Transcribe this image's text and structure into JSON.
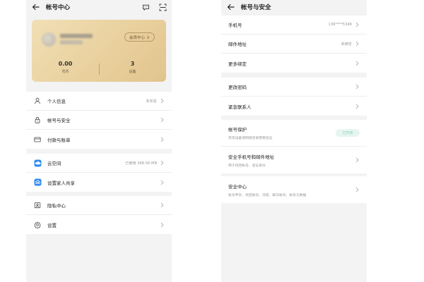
{
  "left": {
    "title": "帐号中心",
    "card": {
      "member_button": "会员中心",
      "stats": [
        {
          "value": "0.00",
          "label": "花币"
        },
        {
          "value": "3",
          "label": "设备"
        }
      ]
    },
    "items": [
      {
        "label": "个人信息",
        "value": "未实名",
        "icon": "person-icon"
      },
      {
        "label": "帐号与安全",
        "value": "",
        "icon": "lock-icon"
      },
      {
        "label": "付款与账单",
        "value": "",
        "icon": "card-icon"
      },
      {
        "label": "云空间",
        "value": "已使用 368.56 MB",
        "icon": "cloud-icon"
      },
      {
        "label": "设置家人共享",
        "value": "",
        "icon": "family-icon"
      },
      {
        "label": "隐私中心",
        "value": "",
        "icon": "privacy-icon"
      },
      {
        "label": "设置",
        "value": "",
        "icon": "gear-icon"
      }
    ]
  },
  "right": {
    "title": "帐号与安全",
    "group1": [
      {
        "label": "手机号",
        "value": "136****5346"
      },
      {
        "label": "邮件地址",
        "value": "未绑定"
      },
      {
        "label": "更多绑定",
        "value": ""
      }
    ],
    "group2": [
      {
        "label": "更改密码",
        "value": ""
      },
      {
        "label": "紧急联系人",
        "value": ""
      }
    ],
    "group3": [
      {
        "label": "帐号保护",
        "sub": "异常设备或网络登录需要验证",
        "chip": "已开启"
      },
      {
        "label": "安全手机号和邮件地址",
        "sub": "用于找回帐号、验证身份"
      }
    ],
    "group4": [
      {
        "label": "安全中心",
        "sub": "账号申诉、找回账号、冻结、解冻帐号、帐号与数据"
      }
    ]
  },
  "colors": {
    "accent": "#e6cc98",
    "background": "#f3f3f4"
  }
}
